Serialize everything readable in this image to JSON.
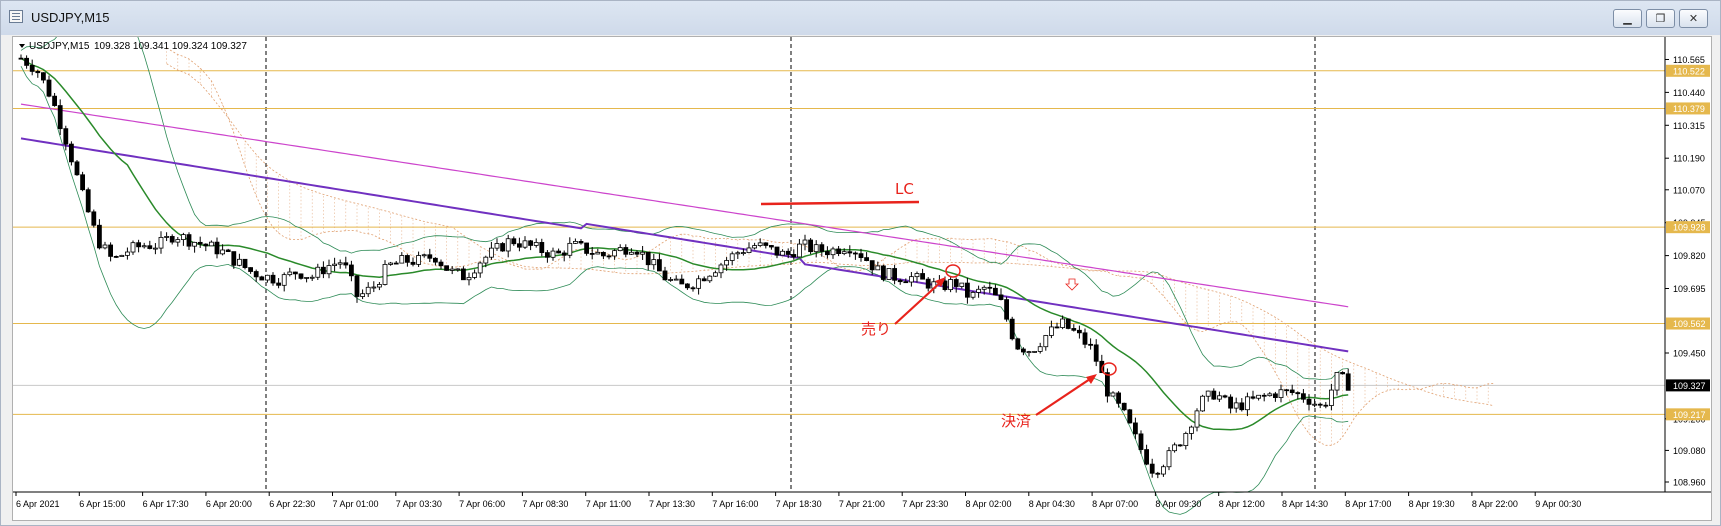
{
  "window": {
    "title": "USDJPY,M15",
    "buttons": {
      "minimize": "▁",
      "restore": "❐",
      "close": "✕"
    }
  },
  "header": {
    "symbol_label": "USDJPY,M15",
    "ohlc": "109.328 109.341 109.324 109.327"
  },
  "annotations": {
    "lc": "LC",
    "sell": "売り",
    "settle": "決済"
  },
  "colors": {
    "ma_magenta": "#cc44cc",
    "ma_purple": "#7030c0",
    "ma_green": "#2a8a2a",
    "bollinger": "#2e8b57",
    "level_lines": "#e5b84d",
    "annotation_red": "#e8231c",
    "cloud": "#e0a070"
  },
  "chart_data": {
    "type": "candlestick",
    "symbol": "USDJPY",
    "timeframe": "M15",
    "ylim": [
      108.96,
      110.62
    ],
    "y_ticks": [
      "110.565",
      "110.440",
      "110.315",
      "110.190",
      "110.070",
      "109.945",
      "109.820",
      "109.695",
      "109.450",
      "109.200",
      "109.080",
      "108.960"
    ],
    "x_ticks": [
      "6 Apr 2021",
      "6 Apr 15:00",
      "6 Apr 17:30",
      "6 Apr 20:00",
      "6 Apr 22:30",
      "7 Apr 01:00",
      "7 Apr 03:30",
      "7 Apr 06:00",
      "7 Apr 08:30",
      "7 Apr 11:00",
      "7 Apr 13:30",
      "7 Apr 16:00",
      "7 Apr 18:30",
      "7 Apr 21:00",
      "7 Apr 23:30",
      "8 Apr 02:00",
      "8 Apr 04:30",
      "8 Apr 07:00",
      "8 Apr 09:30",
      "8 Apr 12:00",
      "8 Apr 14:30",
      "8 Apr 17:00",
      "8 Apr 19:30",
      "8 Apr 22:00",
      "9 Apr 00:30"
    ],
    "horizontal_levels": [
      {
        "label": "110.522",
        "value": 110.522
      },
      {
        "label": "110.379",
        "value": 110.379
      },
      {
        "label": "109.928",
        "value": 109.928
      },
      {
        "label": "109.562",
        "value": 109.562
      },
      {
        "label": "109.217",
        "value": 109.217
      }
    ],
    "current_price": {
      "label": "109.327",
      "value": 109.327
    },
    "close_path": [
      110.57,
      110.53,
      110.42,
      110.25,
      110.05,
      109.88,
      109.8,
      109.84,
      109.86,
      109.86,
      109.9,
      109.88,
      109.86,
      109.84,
      109.8,
      109.76,
      109.74,
      109.73,
      109.76,
      109.74,
      109.78,
      109.8,
      109.66,
      109.7,
      109.78,
      109.8,
      109.8,
      109.82,
      109.76,
      109.74,
      109.8,
      109.84,
      109.88,
      109.86,
      109.84,
      109.82,
      109.86,
      109.84,
      109.82,
      109.84,
      109.86,
      109.8,
      109.74,
      109.7,
      109.72,
      109.76,
      109.8,
      109.84,
      109.86,
      109.84,
      109.82,
      109.86,
      109.84,
      109.84,
      109.86,
      109.82,
      109.76,
      109.74,
      109.74,
      109.72,
      109.7,
      109.72,
      109.66,
      109.7,
      109.64,
      109.48,
      109.46,
      109.52,
      109.56,
      109.52,
      109.46,
      109.3,
      109.22,
      109.1,
      109.0,
      109.06,
      109.14,
      109.26,
      109.3,
      109.24,
      109.26,
      109.28,
      109.3,
      109.3,
      109.28,
      109.24,
      109.36,
      109.32
    ],
    "signals": [
      {
        "label": "売り",
        "value": 109.7
      },
      {
        "label": "決済",
        "value": 109.3
      }
    ],
    "lc_level": 109.95
  }
}
